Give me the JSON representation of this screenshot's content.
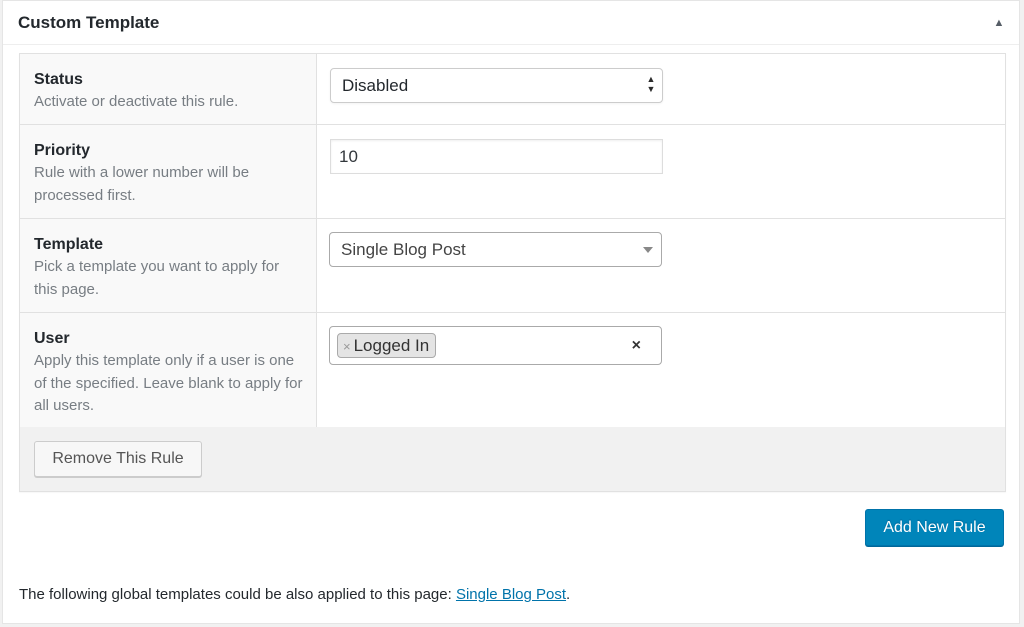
{
  "metabox": {
    "title": "Custom Template",
    "toggle_icon": "▲"
  },
  "rules": {
    "status": {
      "label": "Status",
      "description": "Activate or deactivate this rule.",
      "selected": "Disabled"
    },
    "priority": {
      "label": "Priority",
      "description": "Rule with a lower number will be processed first.",
      "value": "10"
    },
    "template": {
      "label": "Template",
      "description": "Pick a template you want to apply for this page.",
      "selected": "Single Blog Post"
    },
    "user": {
      "label": "User",
      "description": "Apply this template only if a user is one of the specified. Leave blank to apply for all users.",
      "tags": [
        "Logged In"
      ],
      "tag_remove_icon": "×",
      "clear_icon": "×"
    },
    "remove_button": "Remove This Rule"
  },
  "add_button": "Add New Rule",
  "footer": {
    "note_prefix": "The following global templates could be also applied to this page: ",
    "link_text": "Single Blog Post",
    "note_suffix": "."
  }
}
